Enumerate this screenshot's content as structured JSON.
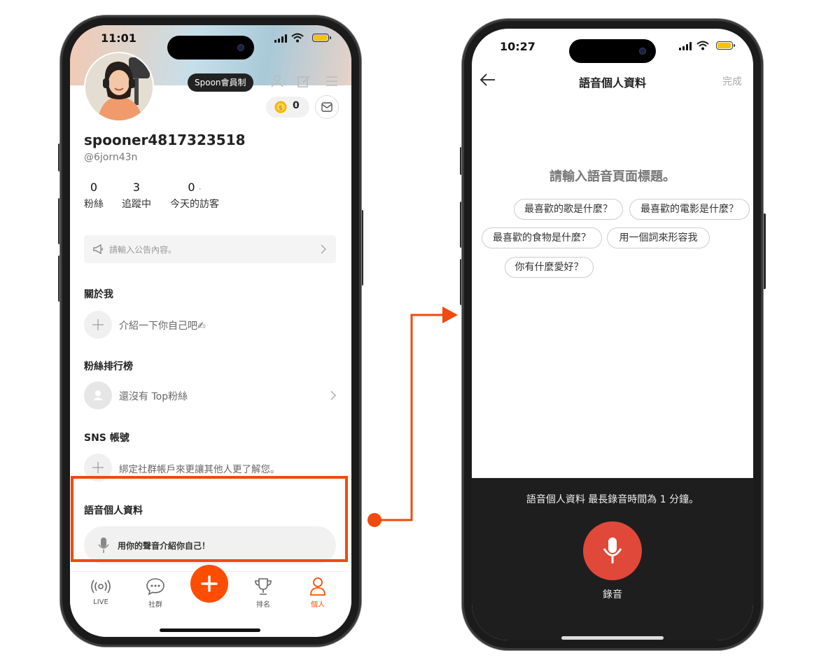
{
  "left": {
    "status": {
      "time": "11:01"
    },
    "membership_badge": "Spoon會員制",
    "coins": "0",
    "username": "spooner4817323518",
    "handle": "@6jorn43n",
    "stats": [
      {
        "value": "0",
        "label": "粉絲"
      },
      {
        "value": "3",
        "label": "追蹤中"
      },
      {
        "value": "0",
        "label": "今天的訪客",
        "suffix": "-"
      }
    ],
    "announcement_placeholder": "請輸入公告內容。",
    "about": {
      "title": "關於我",
      "text": "介紹一下你自己吧✍"
    },
    "fan_rank": {
      "title": "粉絲排行榜",
      "text": "還沒有 Top粉絲"
    },
    "sns": {
      "title": "SNS 帳號",
      "text": "綁定社群帳戶來更讓其他人更了解您。"
    },
    "voice_profile": {
      "title": "語音個人資料",
      "button": "用你的聲音介紹你自己！"
    },
    "nav": [
      {
        "label": "LIVE",
        "icon": "live-icon",
        "active": false
      },
      {
        "label": "社群",
        "icon": "chat-icon",
        "active": false
      },
      {
        "label": "",
        "icon": "plus-icon",
        "active": false
      },
      {
        "label": "排名",
        "icon": "trophy-icon",
        "active": false
      },
      {
        "label": "個人",
        "icon": "person-icon",
        "active": true
      }
    ]
  },
  "right": {
    "status": {
      "time": "10:27"
    },
    "header": {
      "title": "語音個人資料",
      "done": "完成"
    },
    "prompt": "請輸入語音頁面標題。",
    "chips": [
      "最喜歡的歌是什麼？",
      "最喜歡的電影是什麼？",
      "最喜歡的食物是什麼？",
      "用一個詞來形容我",
      "你有什麼愛好？"
    ],
    "recording_note": "語音個人資料 最長錄音時間為 1 分鐘。",
    "record_label": "錄音"
  },
  "colors": {
    "accent": "#ff4d00",
    "record": "#e0483a",
    "dark_panel": "#1e1e1e"
  }
}
